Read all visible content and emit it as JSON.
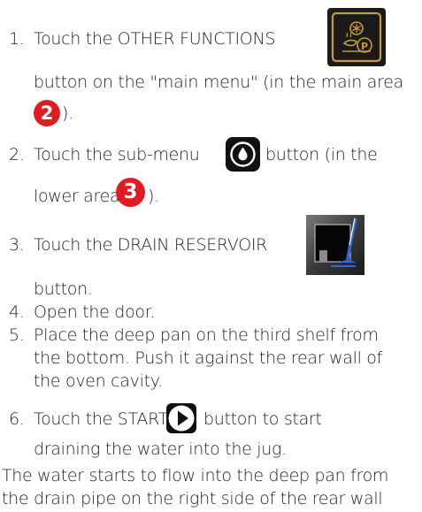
{
  "steps": [
    {
      "num": "1.",
      "text_a": "Touch the OTHER FUNCTIONS",
      "text_b": "button on the \"main menu\" (in the main area",
      "badge": "2",
      "suffix": ")."
    },
    {
      "num": "2.",
      "text_a": "Touch the sub-menu",
      "text_b": "button (in the",
      "text_c": "lower area",
      "badge": "3",
      "suffix": ")."
    },
    {
      "num": "3.",
      "text_a": "Touch the DRAIN RESERVOIR",
      "text_b": "button."
    },
    {
      "num": "4.",
      "text": "Open the door."
    },
    {
      "num": "5.",
      "text_a": "Place the deep pan on the third shelf from",
      "text_b": "the bottom. Push it against the rear wall of",
      "text_c": "the oven cavity."
    },
    {
      "num": "6.",
      "text_a": "Touch the START",
      "text_b": "button to start",
      "text_c": "draining the water into the jug."
    }
  ],
  "footer": {
    "line1": "The water starts to flow into the deep pan from",
    "line2": "the drain pipe on the right side of the rear wall"
  },
  "icons": {
    "other_functions": "other-functions-icon",
    "water_drop": "water-drop-icon",
    "drain_reservoir": "drain-reservoir-icon",
    "start": "start-play-icon"
  },
  "colors": {
    "text": "#222222",
    "badge": "#e01b22",
    "icon_gold": "#c79a3c",
    "icon_dark": "#1a1a1a",
    "drain_blue": "#2f6bd8"
  }
}
